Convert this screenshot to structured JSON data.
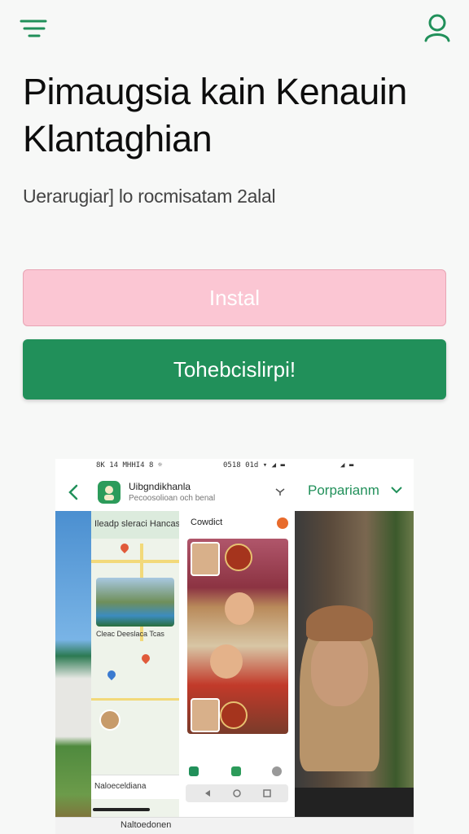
{
  "header": {
    "menu_icon": "hamburger-menu-icon",
    "profile_icon": "user-icon",
    "accent": "#21905a"
  },
  "hero": {
    "title": "Pimaugsia kain Kenauin Klantaghian",
    "subtitle": "Uerarugiar] lo rocmisatam 2alal"
  },
  "buttons": {
    "install_label": "Instal",
    "primary_label": "Tohebcislirpi!",
    "install_color": "#fbc6d3",
    "primary_color": "#21905a"
  },
  "preview": {
    "status_left": "8K 14 MHHI4 8 ☼",
    "status_mid": "0518 01d ▾ ◢ ▬",
    "status_right": "◢ ▬",
    "app_name": "Uibgndikhanla",
    "app_sub": "Pecoosolioan och benal",
    "map_header": "Ileadp sleraci Hancas",
    "map_caption": "Cleac Deeslaca Tcas",
    "map_footer": "Naloeceldiana",
    "story_title": "Cowdict",
    "right_title": "Porparianm",
    "bottom_text": "Naltoedonen"
  }
}
